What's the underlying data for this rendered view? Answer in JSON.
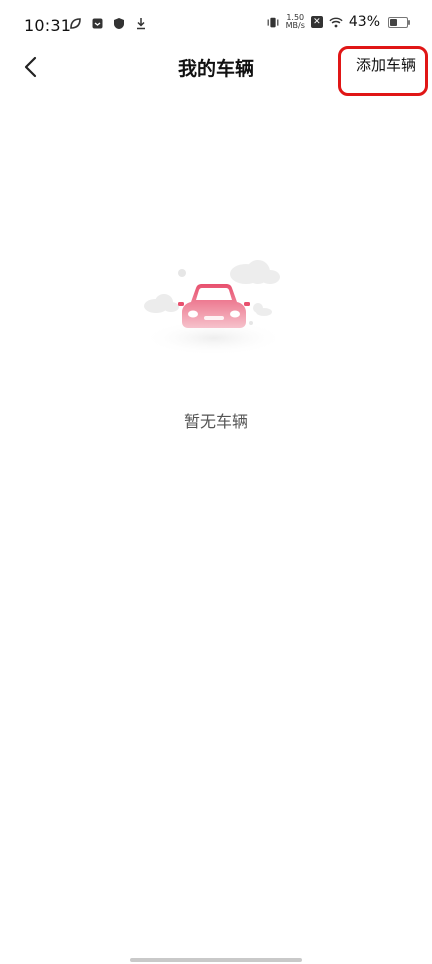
{
  "status_bar": {
    "time": "10:31",
    "net_speed_value": "1.50",
    "net_speed_unit": "MB/s",
    "battery": "43%",
    "battery_level": 0.43,
    "icons": [
      "leaf-icon",
      "inbox-icon",
      "shield-icon",
      "download-icon",
      "vibrate-icon",
      "x-icon",
      "wifi-icon",
      "battery-icon"
    ]
  },
  "header": {
    "title": "我的车辆",
    "add_label": "添加车辆",
    "back_icon": "chevron-left-icon"
  },
  "empty_state": {
    "message": "暂无车辆",
    "illustration": "car-icon"
  },
  "colors": {
    "accent": "#e8506e",
    "highlight": "#e01616"
  }
}
